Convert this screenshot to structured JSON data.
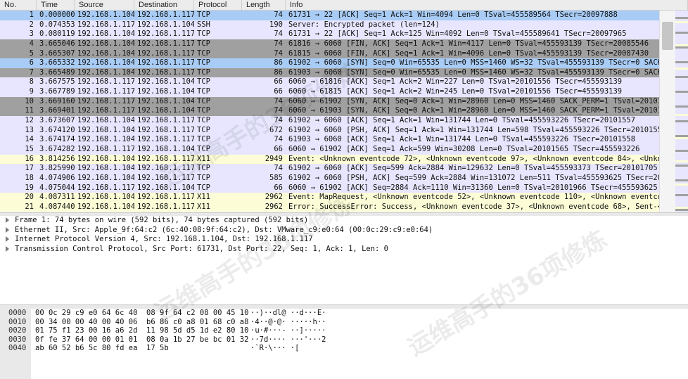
{
  "columns": [
    "No.",
    "Time",
    "Source",
    "Destination",
    "Protocol",
    "Length",
    "Info"
  ],
  "colors": {
    "selected": "#a8ccf5",
    "tcp": "#e7e6fe",
    "ssh": "#e7e6fe",
    "x11": "#fcfdd6",
    "gray_flag": "#a0a0a0"
  },
  "packets": [
    {
      "no": "1",
      "time": "0.000000",
      "src": "192.168.1.104",
      "dst": "192.168.1.117",
      "proto": "TCP",
      "len": "74",
      "info": "61731 → 22 [ACK] Seq=1 Ack=1 Win=4094 Len=0 TSval=455589564 TSecr=20097888",
      "style": "selected"
    },
    {
      "no": "2",
      "time": "0.074353",
      "src": "192.168.1.117",
      "dst": "192.168.1.104",
      "proto": "SSH",
      "len": "190",
      "info": "Server: Encrypted packet (len=124)",
      "style": "tcp"
    },
    {
      "no": "3",
      "time": "0.080119",
      "src": "192.168.1.104",
      "dst": "192.168.1.117",
      "proto": "TCP",
      "len": "74",
      "info": "61731 → 22 [ACK] Seq=1 Ack=125 Win=4092 Len=0 TSval=455589641 TSecr=20097965",
      "style": "tcp"
    },
    {
      "no": "4",
      "time": "3.665046",
      "src": "192.168.1.104",
      "dst": "192.168.1.117",
      "proto": "TCP",
      "len": "74",
      "info": "61816 → 6060 [FIN, ACK] Seq=1 Ack=1 Win=4117 Len=0 TSval=455593139 TSecr=20085546",
      "style": "gray"
    },
    {
      "no": "5",
      "time": "3.665307",
      "src": "192.168.1.104",
      "dst": "192.168.1.117",
      "proto": "TCP",
      "len": "74",
      "info": "61815 → 6060 [FIN, ACK] Seq=1 Ack=1 Win=4096 Len=0 TSval=455593139 TSecr=20087430",
      "style": "gray"
    },
    {
      "no": "6",
      "time": "3.665332",
      "src": "192.168.1.104",
      "dst": "192.168.1.117",
      "proto": "TCP",
      "len": "86",
      "info": "61902 → 6060 [SYN] Seq=0 Win=65535 Len=0 MSS=1460 WS=32 TSval=455593139 TSecr=0 SACK_PERM",
      "style": "selected2"
    },
    {
      "no": "7",
      "time": "3.665489",
      "src": "192.168.1.104",
      "dst": "192.168.1.117",
      "proto": "TCP",
      "len": "86",
      "info": "61903 → 6060 [SYN] Seq=0 Win=65535 Len=0 MSS=1460 WS=32 TSval=455593139 TSecr=0 SACK_PERM",
      "style": "gray"
    },
    {
      "no": "8",
      "time": "3.667575",
      "src": "192.168.1.117",
      "dst": "192.168.1.104",
      "proto": "TCP",
      "len": "66",
      "info": "6060 → 61816 [ACK] Seq=1 Ack=2 Win=227 Len=0 TSval=20101556 TSecr=455593139",
      "style": "tcp"
    },
    {
      "no": "9",
      "time": "3.667789",
      "src": "192.168.1.117",
      "dst": "192.168.1.104",
      "proto": "TCP",
      "len": "66",
      "info": "6060 → 61815 [ACK] Seq=1 Ack=2 Win=245 Len=0 TSval=20101556 TSecr=455593139",
      "style": "tcp"
    },
    {
      "no": "10",
      "time": "3.669160",
      "src": "192.168.1.117",
      "dst": "192.168.1.104",
      "proto": "TCP",
      "len": "74",
      "info": "6060 → 61902 [SYN, ACK] Seq=0 Ack=1 Win=28960 Len=0 MSS=1460 SACK_PERM=1 TSval=20101557 T",
      "style": "gray"
    },
    {
      "no": "11",
      "time": "3.669401",
      "src": "192.168.1.117",
      "dst": "192.168.1.104",
      "proto": "TCP",
      "len": "74",
      "info": "6060 → 61903 [SYN, ACK] Seq=0 Ack=1 Win=28960 Len=0 MSS=1460 SACK_PERM=1 TSval=20101558 T",
      "style": "gray"
    },
    {
      "no": "12",
      "time": "3.673607",
      "src": "192.168.1.104",
      "dst": "192.168.1.117",
      "proto": "TCP",
      "len": "74",
      "info": "61902 → 6060 [ACK] Seq=1 Ack=1 Win=131744 Len=0 TSval=455593226 TSecr=20101557",
      "style": "tcp"
    },
    {
      "no": "13",
      "time": "3.674120",
      "src": "192.168.1.104",
      "dst": "192.168.1.117",
      "proto": "TCP",
      "len": "672",
      "info": "61902 → 6060 [PSH, ACK] Seq=1 Ack=1 Win=131744 Len=598 TSval=455593226 TSecr=20101557 [TC",
      "style": "tcp"
    },
    {
      "no": "14",
      "time": "3.674174",
      "src": "192.168.1.104",
      "dst": "192.168.1.117",
      "proto": "TCP",
      "len": "74",
      "info": "61903 → 6060 [ACK] Seq=1 Ack=1 Win=131744 Len=0 TSval=455593226 TSecr=20101558",
      "style": "tcp"
    },
    {
      "no": "15",
      "time": "3.674282",
      "src": "192.168.1.117",
      "dst": "192.168.1.104",
      "proto": "TCP",
      "len": "66",
      "info": "6060 → 61902 [ACK] Seq=1 Ack=599 Win=30208 Len=0 TSval=20101565 TSecr=455593226",
      "style": "tcp"
    },
    {
      "no": "16",
      "time": "3.814256",
      "src": "192.168.1.104",
      "dst": "192.168.1.117",
      "proto": "X11",
      "len": "2949",
      "info": "Event: <Unknown eventcode 72>, <Unknown eventcode 97>, <Unknown eventcode 84>, <Unknown e",
      "style": "x11"
    },
    {
      "no": "17",
      "time": "3.825990",
      "src": "192.168.1.104",
      "dst": "192.168.1.117",
      "proto": "TCP",
      "len": "74",
      "info": "61902 → 6060 [ACK] Seq=599 Ack=2884 Win=129632 Len=0 TSval=455593373 TSecr=20101705",
      "style": "tcp"
    },
    {
      "no": "18",
      "time": "4.074906",
      "src": "192.168.1.104",
      "dst": "192.168.1.117",
      "proto": "TCP",
      "len": "585",
      "info": "61902 → 6060 [PSH, ACK] Seq=599 Ack=2884 Win=131072 Len=511 TSval=455593625 TSecr=2010170",
      "style": "tcp"
    },
    {
      "no": "19",
      "time": "4.075044",
      "src": "192.168.1.117",
      "dst": "192.168.1.104",
      "proto": "TCP",
      "len": "66",
      "info": "6060 → 61902 [ACK] Seq=2884 Ack=1110 Win=31360 Len=0 TSval=20101966 TSecr=455593625",
      "style": "tcp"
    },
    {
      "no": "20",
      "time": "4.087311",
      "src": "192.168.1.104",
      "dst": "192.168.1.117",
      "proto": "X11",
      "len": "2962",
      "info": "Event: MapRequest, <Unknown eventcode 52>, <Unknown eventcode 110>, <Unknown eventcode 11",
      "style": "x11"
    },
    {
      "no": "21",
      "time": "4.087440",
      "src": "192.168.1.104",
      "dst": "192.168.1.117",
      "proto": "X11",
      "len": "2962",
      "info": "Error: SuccessError: Success, <Unknown eventcode 37>, <Unknown eventcode 68>, Sent-<Unknown ever",
      "style": "x11"
    }
  ],
  "details": [
    "Frame 1: 74 bytes on wire (592 bits), 74 bytes captured (592 bits)",
    "Ethernet II, Src: Apple_9f:64:c2 (6c:40:08:9f:64:c2), Dst: VMware_c9:e0:64 (00:0c:29:c9:e0:64)",
    "Internet Protocol Version 4, Src: 192.168.1.104, Dst: 192.168.1.117",
    "Transmission Control Protocol, Src Port: 61731, Dst Port: 22, Seq: 1, Ack: 1, Len: 0"
  ],
  "hex": [
    {
      "off": "0000",
      "bytes": "00 0c 29 c9 e0 64 6c 40  08 9f 64 c2 08 00 45 10",
      "ascii": "··)··dl@ ··d···E·"
    },
    {
      "off": "0010",
      "bytes": "00 34 00 00 40 00 40 06  b6 86 c0 a8 01 68 c0 a8",
      "ascii": "·4··@·@· ·····h··"
    },
    {
      "off": "0020",
      "bytes": "01 75 f1 23 00 16 a6 2d  11 98 5d d5 1d e2 80 10",
      "ascii": "·u·#···- ··]·····"
    },
    {
      "off": "0030",
      "bytes": "0f fe 37 64 00 00 01 01  08 0a 1b 27 be bc 01 32",
      "ascii": "··7d···· ···'···2"
    },
    {
      "off": "0040",
      "bytes": "ab 60 52 b6 5c 80 fd ea  17 5b",
      "ascii": "·`R·\\··· ·["
    }
  ],
  "watermark": "运维高手的36项修炼"
}
